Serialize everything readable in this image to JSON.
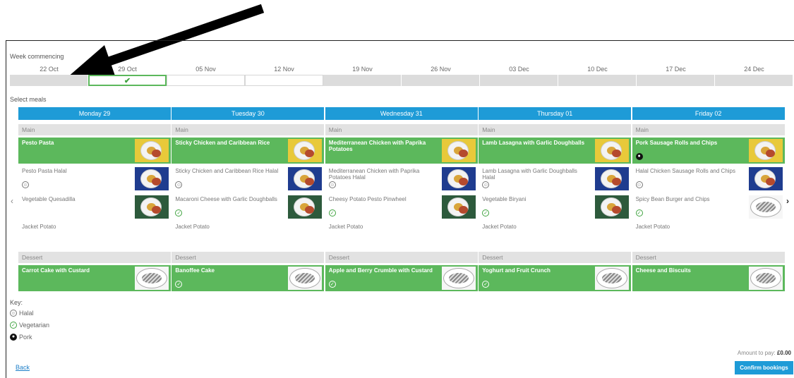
{
  "week": {
    "label": "Week commencing",
    "dates": [
      "22 Oct",
      "29 Oct",
      "05 Nov",
      "12 Nov",
      "19 Nov",
      "26 Nov",
      "03 Dec",
      "10 Dec",
      "17 Dec",
      "24 Dec"
    ],
    "selected_check": "✔"
  },
  "select_meals_label": "Select meals",
  "nav": {
    "prev": "‹",
    "next": "›"
  },
  "days": [
    {
      "header": "Monday 29",
      "main_label": "Main",
      "mains": [
        {
          "name": "Pesto Pasta",
          "selected": true,
          "icon": null,
          "photo": "yellow-pasta"
        },
        {
          "name": "Pesto Pasta Halal",
          "selected": false,
          "icon": "halal",
          "photo": "blue-pasta"
        },
        {
          "name": "Vegetable Quesadilla",
          "selected": false,
          "icon": null,
          "photo": "green-quesadilla"
        },
        {
          "name": "Jacket Potato",
          "selected": false,
          "icon": null,
          "photo": null
        }
      ],
      "dessert_label": "Dessert",
      "dessert": {
        "name": "Carrot Cake with Custard",
        "selected": true,
        "icon": null,
        "photo": "placeholder"
      }
    },
    {
      "header": "Tuesday 30",
      "main_label": "Main",
      "mains": [
        {
          "name": "Sticky Chicken and Caribbean Rice",
          "selected": true,
          "icon": null,
          "photo": "yellow-chicken"
        },
        {
          "name": "Sticky Chicken and Caribbean Rice Halal",
          "selected": false,
          "icon": "halal",
          "photo": "blue-chicken"
        },
        {
          "name": "Macaroni Cheese with Garlic Doughballs",
          "selected": false,
          "icon": "vegetarian",
          "photo": "green-macaroni"
        },
        {
          "name": "Jacket Potato",
          "selected": false,
          "icon": null,
          "photo": null
        }
      ],
      "dessert_label": "Dessert",
      "dessert": {
        "name": "Banoffee Cake",
        "selected": true,
        "icon": "vegetarian",
        "photo": "placeholder"
      }
    },
    {
      "header": "Wednesday 31",
      "main_label": "Main",
      "mains": [
        {
          "name": "Mediterranean Chicken with Paprika Potatoes",
          "selected": true,
          "icon": null,
          "photo": "yellow-chicken"
        },
        {
          "name": "Mediterranean Chicken with Paprika Potatoes Halal",
          "selected": false,
          "icon": "halal",
          "photo": "blue-chicken"
        },
        {
          "name": "Cheesy Potato Pesto Pinwheel",
          "selected": false,
          "icon": "vegetarian",
          "photo": "green-pinwheel"
        },
        {
          "name": "Jacket Potato",
          "selected": false,
          "icon": null,
          "photo": null
        }
      ],
      "dessert_label": "Dessert",
      "dessert": {
        "name": "Apple and Berry Crumble with Custard",
        "selected": true,
        "icon": "vegetarian",
        "photo": "placeholder"
      }
    },
    {
      "header": "Thursday 01",
      "main_label": "Main",
      "mains": [
        {
          "name": "Lamb Lasagna with Garlic Doughballs",
          "selected": true,
          "icon": null,
          "photo": "yellow-lasagna"
        },
        {
          "name": "Lamb Lasagna with Garlic Doughballs Halal",
          "selected": false,
          "icon": "halal",
          "photo": "blue-lasagna"
        },
        {
          "name": "Vegetable Biryani",
          "selected": false,
          "icon": "vegetarian",
          "photo": "green-biryani"
        },
        {
          "name": "Jacket Potato",
          "selected": false,
          "icon": null,
          "photo": null
        }
      ],
      "dessert_label": "Dessert",
      "dessert": {
        "name": "Yoghurt and Fruit Crunch",
        "selected": true,
        "icon": "vegetarian",
        "photo": "placeholder"
      }
    },
    {
      "header": "Friday 02",
      "main_label": "Main",
      "mains": [
        {
          "name": "Pork Sausage Rolls and Chips",
          "selected": true,
          "icon": "pork",
          "photo": "yellow-sausage"
        },
        {
          "name": "Halal Chicken Sausage Rolls and Chips",
          "selected": false,
          "icon": "halal",
          "photo": "blue-sausage"
        },
        {
          "name": "Spicy Bean Burger and Chips",
          "selected": false,
          "icon": "vegetarian",
          "photo": "placeholder"
        },
        {
          "name": "Jacket Potato",
          "selected": false,
          "icon": null,
          "photo": null
        }
      ],
      "dessert_label": "Dessert",
      "dessert": {
        "name": "Cheese and Biscuits",
        "selected": true,
        "icon": null,
        "photo": "placeholder"
      }
    }
  ],
  "key": {
    "title": "Key:",
    "items": [
      {
        "icon": "halal",
        "label": "Halal"
      },
      {
        "icon": "vegetarian",
        "label": "Vegetarian"
      },
      {
        "icon": "pork",
        "label": "Pork"
      }
    ]
  },
  "footer": {
    "back": "Back",
    "amount_label": "Amount to pay:",
    "amount_value": "£0.00",
    "confirm": "Confirm bookings"
  },
  "colors": {
    "selected_green": "#5cb85c",
    "header_blue": "#1e9bd7",
    "arrow": "#000000"
  }
}
